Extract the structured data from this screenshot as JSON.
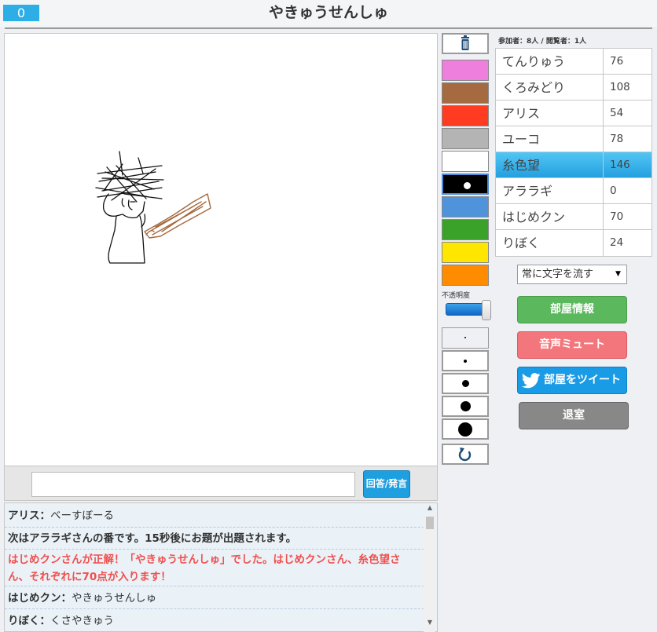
{
  "header": {
    "timer": "0",
    "title": "やきゅうせんしゅ"
  },
  "tools": {
    "colors": [
      "#ef7fdc",
      "#a56a40",
      "#ff3b22",
      "#b4b4b4",
      "#ffffff",
      "#000000",
      "#4f94db",
      "#3ba229",
      "#ffe600",
      "#ff8c00"
    ],
    "selected_color_index": 5,
    "opacity_label": "不透明度",
    "opacity_level": 1.0,
    "brush_sizes": [
      1,
      2,
      3,
      4,
      5
    ],
    "selected_brush_index": 0
  },
  "players": {
    "count_text": "参加者：8人 / 閲覧者：1人",
    "list": [
      {
        "name": "てんりゅう",
        "score": "76"
      },
      {
        "name": "くろみどり",
        "score": "108"
      },
      {
        "name": "アリス",
        "score": "54"
      },
      {
        "name": "ユーコ",
        "score": "78"
      },
      {
        "name": "糸色望",
        "score": "146"
      },
      {
        "name": "アララギ",
        "score": "0"
      },
      {
        "name": "はじめクン",
        "score": "70"
      },
      {
        "name": "りぼく",
        "score": "24"
      }
    ],
    "active_index": 4
  },
  "controls": {
    "text_mode": "常に文字を流す",
    "room_info": "部屋情報",
    "mute": "音声ミュート",
    "tweet": "部屋をツイート",
    "leave": "退室"
  },
  "answer": {
    "placeholder": "",
    "button": "回答/発言"
  },
  "chat": {
    "sep": "：",
    "rows": [
      {
        "who": "アリス",
        "msg": "ベーすぼーる"
      },
      {
        "system": "次はアララギさんの番です。15秒後にお題が出題されます。"
      },
      {
        "correct1": "はじめクンさんが正解！「やきゅうせんしゅ」でした。はじめクンさん、糸色望さ",
        "correct2": "ん、それぞれに70点が入ります！"
      },
      {
        "who": "はじめクン",
        "msg": "やきゅうせんしゅ"
      },
      {
        "who": "りぼく",
        "msg": "くさやきゅう"
      }
    ]
  }
}
